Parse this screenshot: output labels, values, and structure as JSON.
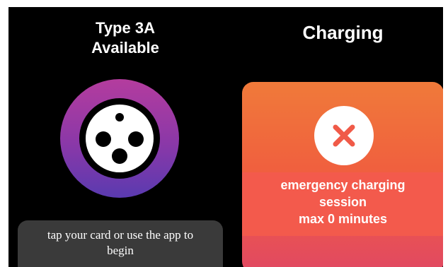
{
  "connector": {
    "type_label": "Type 3A",
    "availability": "Available",
    "icon": "type-3a-connector-icon",
    "ring_colors": [
      "#b43c9e",
      "#5a3ab0"
    ]
  },
  "instruction": {
    "line1": "tap your card or use the app to",
    "line2": "begin"
  },
  "status": {
    "title": "Charging",
    "icon": "close-x-icon",
    "message_line1": "emergency charging",
    "message_line2": "session",
    "message_line3": "max 0 minutes",
    "accent_color": "#f05a48"
  }
}
